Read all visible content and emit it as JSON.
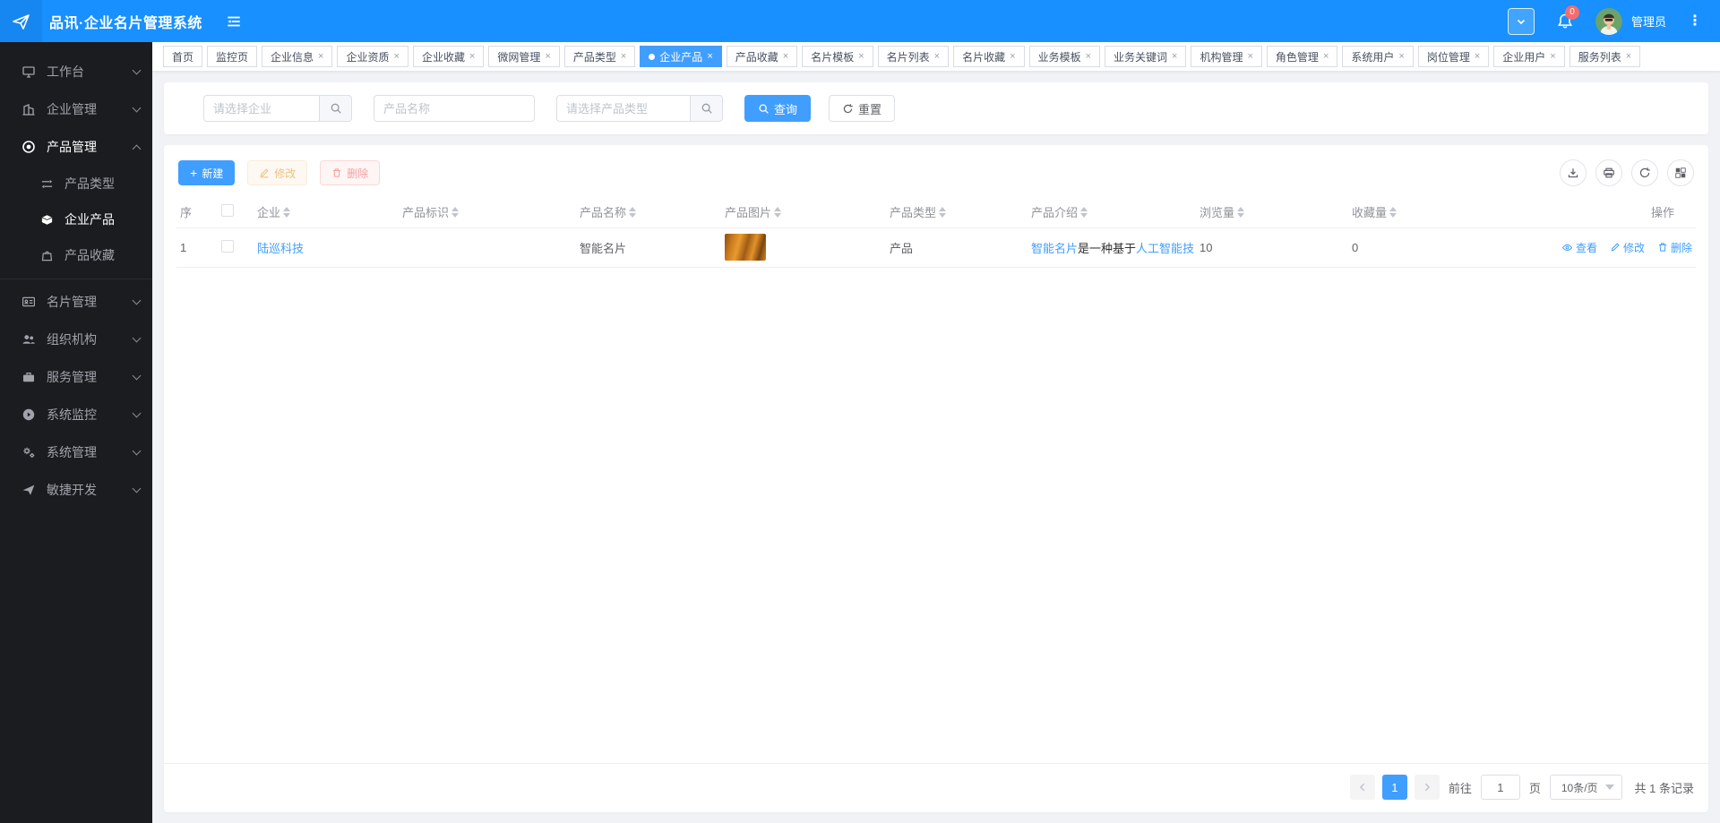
{
  "colors": {
    "header_blue": "#1890ff",
    "accent_blue": "#409eff",
    "danger_red": "#f56c6c",
    "warning_orange": "#e6a23c",
    "sidebar_dark": "#1b1c20",
    "page_bg": "#f0f2f5"
  },
  "header": {
    "title": "品讯·企业名片管理系统",
    "badge_count": "0",
    "admin_label": "管理员"
  },
  "sidebar": {
    "items": [
      {
        "label": "工作台",
        "icon": "monitor-icon"
      },
      {
        "label": "企业管理",
        "icon": "office-building-icon"
      },
      {
        "label": "产品管理",
        "icon": "target-icon",
        "children": [
          {
            "label": "产品类型",
            "icon": "sort-lines-icon"
          },
          {
            "label": "企业产品",
            "icon": "box-icon"
          },
          {
            "label": "产品收藏",
            "icon": "shopping-bag-icon"
          }
        ]
      },
      {
        "label": "名片管理",
        "icon": "id-card-icon"
      },
      {
        "label": "组织机构",
        "icon": "users-icon"
      },
      {
        "label": "服务管理",
        "icon": "briefcase-icon"
      },
      {
        "label": "系统监控",
        "icon": "play-circle-icon"
      },
      {
        "label": "系统管理",
        "icon": "gears-icon"
      },
      {
        "label": "敏捷开发",
        "icon": "paper-plane-icon"
      }
    ]
  },
  "tabs": [
    {
      "label": "首页"
    },
    {
      "label": "监控页"
    },
    {
      "label": "企业信息"
    },
    {
      "label": "企业资质"
    },
    {
      "label": "企业收藏"
    },
    {
      "label": "微网管理"
    },
    {
      "label": "产品类型"
    },
    {
      "label": "企业产品"
    },
    {
      "label": "产品收藏"
    },
    {
      "label": "名片模板"
    },
    {
      "label": "名片列表"
    },
    {
      "label": "名片收藏"
    },
    {
      "label": "业务模板"
    },
    {
      "label": "业务关键词"
    },
    {
      "label": "机构管理"
    },
    {
      "label": "角色管理"
    },
    {
      "label": "系统用户"
    },
    {
      "label": "岗位管理"
    },
    {
      "label": "企业用户"
    },
    {
      "label": "服务列表"
    }
  ],
  "filters": {
    "company_placeholder": "请选择企业",
    "product_name_placeholder": "产品名称",
    "product_type_placeholder": "请选择产品类型",
    "search_label": "查询",
    "reset_label": "重置"
  },
  "toolbar": {
    "add_label": "新建",
    "edit_label": "修改",
    "delete_label": "删除",
    "icons": [
      "download-icon",
      "printer-icon",
      "refresh-icon",
      "grid-icon"
    ]
  },
  "table": {
    "headers": {
      "index": "序",
      "company": "企业",
      "product_code": "产品标识",
      "product_name": "产品名称",
      "product_image": "产品图片",
      "product_type": "产品类型",
      "product_intro": "产品介绍",
      "views": "浏览量",
      "favorites": "收藏量",
      "operation": "操作"
    },
    "rows": [
      {
        "index": "1",
        "company": "陆巡科技",
        "product_code": "",
        "product_name": "智能名片",
        "product_type": "产品",
        "intro_highlight1": "智能名片",
        "intro_plain": "是一种基于",
        "intro_highlight2": "人工智能技",
        "views": "10",
        "favorites": "0",
        "actions": {
          "view": "查看",
          "edit": "修改",
          "delete": "删除"
        }
      }
    ]
  },
  "pagination": {
    "current_page": "1",
    "goto_label": "前往",
    "goto_value": "1",
    "page_unit_label": "页",
    "page_size": "10条/页",
    "total_label": "共 1 条记录"
  }
}
